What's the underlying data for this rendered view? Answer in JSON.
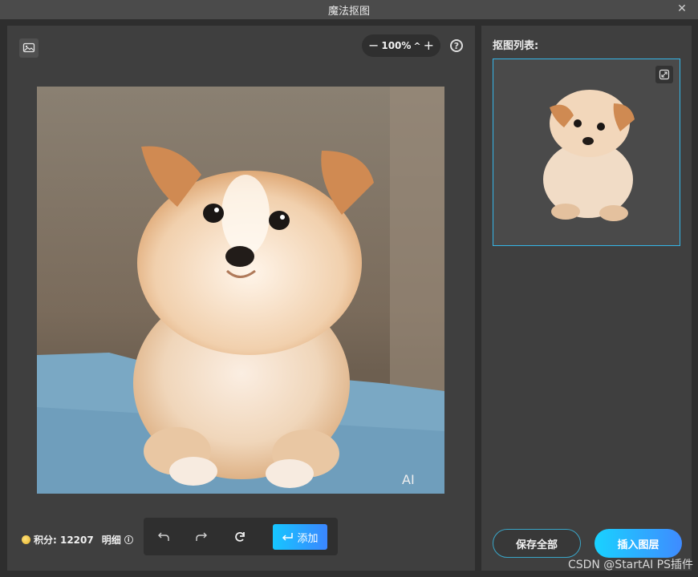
{
  "window": {
    "title": "魔法抠图"
  },
  "editor": {
    "zoom_value": "100%",
    "zoom_minus": "−",
    "zoom_plus": "+",
    "zoom_caret": "^",
    "help": "?",
    "points_label": "积分: 12207",
    "points_detail": "明细",
    "add_label": "添加",
    "image_watermark": "AI"
  },
  "panel": {
    "list_title": "抠图列表:",
    "save_all_label": "保存全部",
    "insert_label": "插入图层"
  },
  "footer": {
    "watermark": "CSDN @StartAI PS插件"
  },
  "colors": {
    "accent_start": "#16c6ff",
    "accent_end": "#3b86ff",
    "selected_border": "#35b6e8"
  },
  "icons": [
    "image-replace-icon",
    "help-icon",
    "coin-icon",
    "info-icon",
    "undo-icon",
    "redo-icon",
    "refresh-icon",
    "return-icon",
    "expand-icon",
    "close-icon"
  ]
}
